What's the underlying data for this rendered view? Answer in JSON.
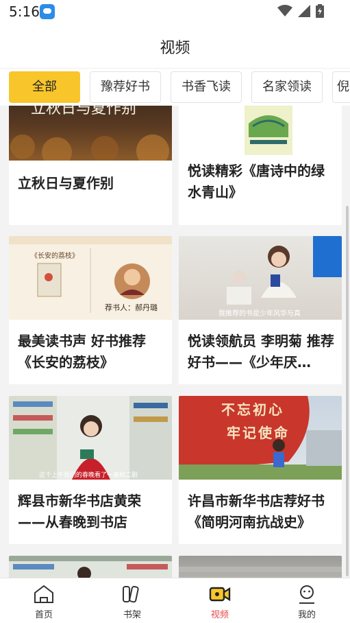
{
  "status_bar": {
    "time": "5:16",
    "icons": [
      "app-icon",
      "wifi-icon",
      "signal-icon",
      "battery-icon"
    ]
  },
  "header": {
    "title": "视频"
  },
  "tabs": [
    {
      "label": "全部",
      "active": true
    },
    {
      "label": "豫荐好书",
      "active": false
    },
    {
      "label": "书香飞读",
      "active": false
    },
    {
      "label": "名家领读",
      "active": false
    },
    {
      "label": "倪",
      "active": false
    }
  ],
  "videos": [
    {
      "title": "立秋日与夏作别",
      "thumb_text": "立秋日与夏作别"
    },
    {
      "title": "悦读精彩《唐诗中的绿水青山》"
    },
    {
      "title": "最美读书声 好书推荐《长安的荔枝》",
      "thumb_text": {
        "book": "《长安的荔枝》",
        "reader": "荐书人：郝丹璐"
      }
    },
    {
      "title": "悦读领航员 李明菊 推荐好书——《少年厌…",
      "thumb_text": {
        "caption": "我推荐的书是少年风华与真"
      }
    },
    {
      "title": "辉县市新华书店黄荣——从春晚到书店",
      "thumb_text": {
        "caption": "这个上午我们的春晚看了一遍和二剧"
      }
    },
    {
      "title": "许昌市新华书店荐好书《简明河南抗战史》",
      "thumb_text": {
        "slogan_line1": "不忘初心",
        "slogan_line2": "牢记使命"
      }
    }
  ],
  "bottom_nav": [
    {
      "label": "首页",
      "icon": "home-icon",
      "active": false
    },
    {
      "label": "书架",
      "icon": "bookshelf-icon",
      "active": false
    },
    {
      "label": "视频",
      "icon": "video-icon",
      "active": true
    },
    {
      "label": "我的",
      "icon": "profile-icon",
      "active": false
    }
  ],
  "colors": {
    "accent": "#f8c62b",
    "active_nav": "#e84a4a",
    "background": "#f3f3f3"
  }
}
